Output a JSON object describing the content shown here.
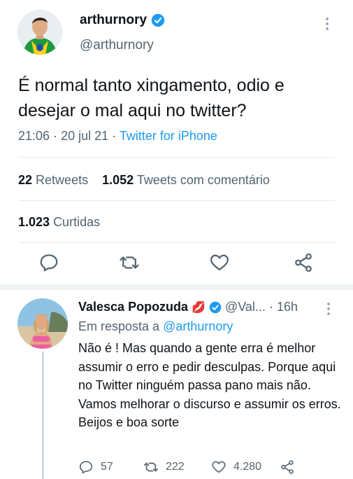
{
  "main_tweet": {
    "display_name": "arthurnory",
    "handle": "@arthurnory",
    "text": "É normal tanto xingamento, odio e desejar o mal aqui no twitter?",
    "time": "21:06",
    "date": "20 jul 21",
    "source": "Twitter for iPhone",
    "retweets_count": "22",
    "retweets_label": "Retweets",
    "quotes_count": "1.052",
    "quotes_label": "Tweets com comentário",
    "likes_count": "1.023",
    "likes_label": "Curtidas"
  },
  "reply_tweet": {
    "display_name": "Valesca Popozuda",
    "emoji": "💋",
    "handle": "@Val...",
    "separator": "·",
    "time": "16h",
    "in_reply_prefix": "Em resposta a",
    "in_reply_mention": "@arthurnory",
    "text": "Não é ! Mas quando a gente erra é melhor assumir o erro e pedir desculpas. Porque aqui no Twitter ninguém passa pano mais não. Vamos melhorar o discurso e assumir os erros. Beijos e boa sorte",
    "reply_count": "57",
    "retweet_count": "222",
    "like_count": "4.280"
  },
  "icons": {
    "verified": "verified-badge-icon",
    "more": "more-vertical-icon",
    "reply": "reply-icon",
    "retweet": "retweet-icon",
    "like": "heart-icon",
    "share": "share-icon"
  },
  "colors": {
    "accent": "#1d9bf0",
    "text": "#0f1419",
    "secondary": "#536471",
    "divider": "#e1e8ed"
  }
}
